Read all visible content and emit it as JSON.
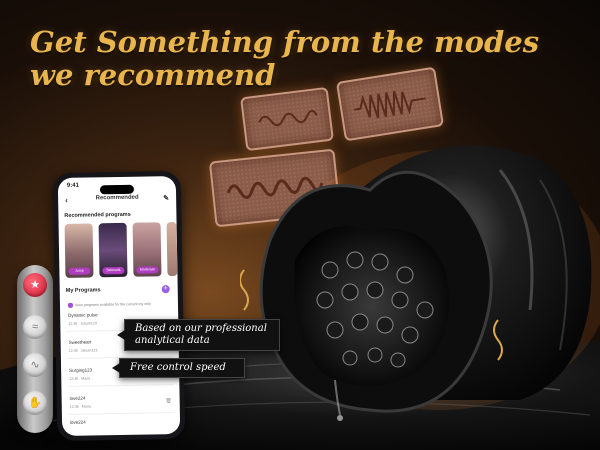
{
  "headline": {
    "line1": "Get Something from the modes",
    "line2": "we recommend"
  },
  "colors": {
    "accent": "#e9b54c",
    "brand_purple": "#9b5de5",
    "remote_red": "#d01830"
  },
  "phone": {
    "status_time": "9:41",
    "nav_title": "Recommended",
    "recommended_title": "Recommended programs",
    "recommended_cards": [
      {
        "tag": "Jump"
      },
      {
        "tag": "Sidewalk"
      },
      {
        "tag": "Moderate"
      }
    ],
    "my_programs_title": "My Programs",
    "checkbox_label": "View programs available for the current toy only",
    "programs": [
      {
        "name": "Dynamic pulse",
        "time": "12:36",
        "author": "Jshum123"
      },
      {
        "name": "Sweetheart",
        "time": "12:36",
        "author": "Jshum123"
      },
      {
        "name": "Surging123",
        "time": "12:36",
        "author": "Maria"
      },
      {
        "name": "love224",
        "time": "12:36",
        "author": "Maria"
      },
      {
        "name": "love224",
        "time": "",
        "author": ""
      }
    ]
  },
  "callouts": {
    "analytical": "Based on our professional analytical data",
    "speed": "Free control speed"
  },
  "remote": {
    "buttons": [
      "power-icon",
      "mode-icon",
      "vibration-icon",
      "hand-icon"
    ]
  }
}
